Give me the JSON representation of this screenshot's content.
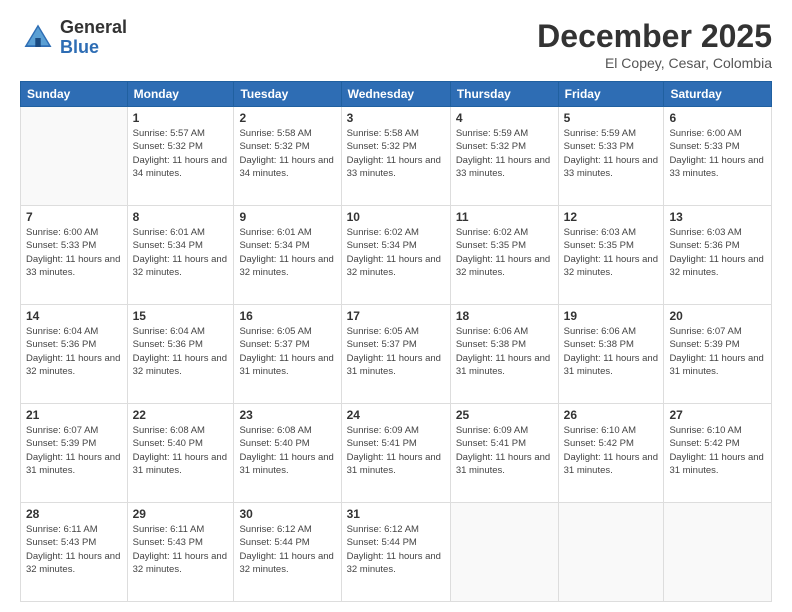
{
  "logo": {
    "general": "General",
    "blue": "Blue"
  },
  "header": {
    "month": "December 2025",
    "location": "El Copey, Cesar, Colombia"
  },
  "weekdays": [
    "Sunday",
    "Monday",
    "Tuesday",
    "Wednesday",
    "Thursday",
    "Friday",
    "Saturday"
  ],
  "weeks": [
    [
      {
        "day": "",
        "sunrise": "",
        "sunset": "",
        "daylight": ""
      },
      {
        "day": "1",
        "sunrise": "Sunrise: 5:57 AM",
        "sunset": "Sunset: 5:32 PM",
        "daylight": "Daylight: 11 hours and 34 minutes."
      },
      {
        "day": "2",
        "sunrise": "Sunrise: 5:58 AM",
        "sunset": "Sunset: 5:32 PM",
        "daylight": "Daylight: 11 hours and 34 minutes."
      },
      {
        "day": "3",
        "sunrise": "Sunrise: 5:58 AM",
        "sunset": "Sunset: 5:32 PM",
        "daylight": "Daylight: 11 hours and 33 minutes."
      },
      {
        "day": "4",
        "sunrise": "Sunrise: 5:59 AM",
        "sunset": "Sunset: 5:32 PM",
        "daylight": "Daylight: 11 hours and 33 minutes."
      },
      {
        "day": "5",
        "sunrise": "Sunrise: 5:59 AM",
        "sunset": "Sunset: 5:33 PM",
        "daylight": "Daylight: 11 hours and 33 minutes."
      },
      {
        "day": "6",
        "sunrise": "Sunrise: 6:00 AM",
        "sunset": "Sunset: 5:33 PM",
        "daylight": "Daylight: 11 hours and 33 minutes."
      }
    ],
    [
      {
        "day": "7",
        "sunrise": "Sunrise: 6:00 AM",
        "sunset": "Sunset: 5:33 PM",
        "daylight": "Daylight: 11 hours and 33 minutes."
      },
      {
        "day": "8",
        "sunrise": "Sunrise: 6:01 AM",
        "sunset": "Sunset: 5:34 PM",
        "daylight": "Daylight: 11 hours and 32 minutes."
      },
      {
        "day": "9",
        "sunrise": "Sunrise: 6:01 AM",
        "sunset": "Sunset: 5:34 PM",
        "daylight": "Daylight: 11 hours and 32 minutes."
      },
      {
        "day": "10",
        "sunrise": "Sunrise: 6:02 AM",
        "sunset": "Sunset: 5:34 PM",
        "daylight": "Daylight: 11 hours and 32 minutes."
      },
      {
        "day": "11",
        "sunrise": "Sunrise: 6:02 AM",
        "sunset": "Sunset: 5:35 PM",
        "daylight": "Daylight: 11 hours and 32 minutes."
      },
      {
        "day": "12",
        "sunrise": "Sunrise: 6:03 AM",
        "sunset": "Sunset: 5:35 PM",
        "daylight": "Daylight: 11 hours and 32 minutes."
      },
      {
        "day": "13",
        "sunrise": "Sunrise: 6:03 AM",
        "sunset": "Sunset: 5:36 PM",
        "daylight": "Daylight: 11 hours and 32 minutes."
      }
    ],
    [
      {
        "day": "14",
        "sunrise": "Sunrise: 6:04 AM",
        "sunset": "Sunset: 5:36 PM",
        "daylight": "Daylight: 11 hours and 32 minutes."
      },
      {
        "day": "15",
        "sunrise": "Sunrise: 6:04 AM",
        "sunset": "Sunset: 5:36 PM",
        "daylight": "Daylight: 11 hours and 32 minutes."
      },
      {
        "day": "16",
        "sunrise": "Sunrise: 6:05 AM",
        "sunset": "Sunset: 5:37 PM",
        "daylight": "Daylight: 11 hours and 31 minutes."
      },
      {
        "day": "17",
        "sunrise": "Sunrise: 6:05 AM",
        "sunset": "Sunset: 5:37 PM",
        "daylight": "Daylight: 11 hours and 31 minutes."
      },
      {
        "day": "18",
        "sunrise": "Sunrise: 6:06 AM",
        "sunset": "Sunset: 5:38 PM",
        "daylight": "Daylight: 11 hours and 31 minutes."
      },
      {
        "day": "19",
        "sunrise": "Sunrise: 6:06 AM",
        "sunset": "Sunset: 5:38 PM",
        "daylight": "Daylight: 11 hours and 31 minutes."
      },
      {
        "day": "20",
        "sunrise": "Sunrise: 6:07 AM",
        "sunset": "Sunset: 5:39 PM",
        "daylight": "Daylight: 11 hours and 31 minutes."
      }
    ],
    [
      {
        "day": "21",
        "sunrise": "Sunrise: 6:07 AM",
        "sunset": "Sunset: 5:39 PM",
        "daylight": "Daylight: 11 hours and 31 minutes."
      },
      {
        "day": "22",
        "sunrise": "Sunrise: 6:08 AM",
        "sunset": "Sunset: 5:40 PM",
        "daylight": "Daylight: 11 hours and 31 minutes."
      },
      {
        "day": "23",
        "sunrise": "Sunrise: 6:08 AM",
        "sunset": "Sunset: 5:40 PM",
        "daylight": "Daylight: 11 hours and 31 minutes."
      },
      {
        "day": "24",
        "sunrise": "Sunrise: 6:09 AM",
        "sunset": "Sunset: 5:41 PM",
        "daylight": "Daylight: 11 hours and 31 minutes."
      },
      {
        "day": "25",
        "sunrise": "Sunrise: 6:09 AM",
        "sunset": "Sunset: 5:41 PM",
        "daylight": "Daylight: 11 hours and 31 minutes."
      },
      {
        "day": "26",
        "sunrise": "Sunrise: 6:10 AM",
        "sunset": "Sunset: 5:42 PM",
        "daylight": "Daylight: 11 hours and 31 minutes."
      },
      {
        "day": "27",
        "sunrise": "Sunrise: 6:10 AM",
        "sunset": "Sunset: 5:42 PM",
        "daylight": "Daylight: 11 hours and 31 minutes."
      }
    ],
    [
      {
        "day": "28",
        "sunrise": "Sunrise: 6:11 AM",
        "sunset": "Sunset: 5:43 PM",
        "daylight": "Daylight: 11 hours and 32 minutes."
      },
      {
        "day": "29",
        "sunrise": "Sunrise: 6:11 AM",
        "sunset": "Sunset: 5:43 PM",
        "daylight": "Daylight: 11 hours and 32 minutes."
      },
      {
        "day": "30",
        "sunrise": "Sunrise: 6:12 AM",
        "sunset": "Sunset: 5:44 PM",
        "daylight": "Daylight: 11 hours and 32 minutes."
      },
      {
        "day": "31",
        "sunrise": "Sunrise: 6:12 AM",
        "sunset": "Sunset: 5:44 PM",
        "daylight": "Daylight: 11 hours and 32 minutes."
      },
      {
        "day": "",
        "sunrise": "",
        "sunset": "",
        "daylight": ""
      },
      {
        "day": "",
        "sunrise": "",
        "sunset": "",
        "daylight": ""
      },
      {
        "day": "",
        "sunrise": "",
        "sunset": "",
        "daylight": ""
      }
    ]
  ]
}
